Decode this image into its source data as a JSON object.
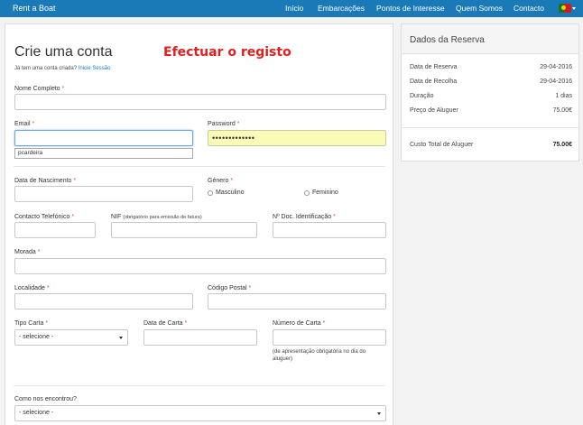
{
  "nav": {
    "brand": "Rent a Boat",
    "links": [
      "Início",
      "Embarcações",
      "Pontos de Interesse",
      "Quem Somos",
      "Contacto"
    ]
  },
  "form": {
    "title": "Crie uma conta",
    "register_title": "Efectuar o registo",
    "have_account": "Já tem uma conta criada?",
    "login_link": "Inicie Sessão",
    "nome_label": "Nome Completo",
    "email_label": "Email",
    "password_label": "Password",
    "password_value": "•••••••••••••",
    "autocomplete_suggestion": "pcardeira",
    "nascimento_label": "Data de Nascimento",
    "genero_label": "Género",
    "masculino_label": "Masculino",
    "feminino_label": "Feminino",
    "telefone_label": "Contacto Telefónico",
    "nif_label": "NIF",
    "nif_note": "(obrigatório para emissão de fatura)",
    "doc_label": "Nº Doc. Identificação",
    "morada_label": "Morada",
    "localidade_label": "Localidade",
    "codigo_postal_label": "Código Postal",
    "tipo_carta_label": "Tipo Carta",
    "tipo_carta_value": "- selecione -",
    "data_carta_label": "Data de Carta",
    "numero_carta_label": "Número de Carta",
    "numero_carta_note_1": "(de apresentação obrigatória no dia do",
    "numero_carta_note_2": "aluguer)",
    "como_label": "Como nos encontrou?",
    "como_value": "- selecione -",
    "required_mark": "*"
  },
  "reservation": {
    "title": "Dados da Reserva",
    "rows": [
      {
        "label": "Data de Reserva",
        "value": "29-04-2016"
      },
      {
        "label": "Data de Recolha",
        "value": "29-04-2016"
      },
      {
        "label": "Duração",
        "value": "1 dias"
      },
      {
        "label": "Preço de Aluguer",
        "value": "75.00€"
      }
    ],
    "total_label": "Custo Total de Aluguer",
    "total_value": "75.00€"
  }
}
